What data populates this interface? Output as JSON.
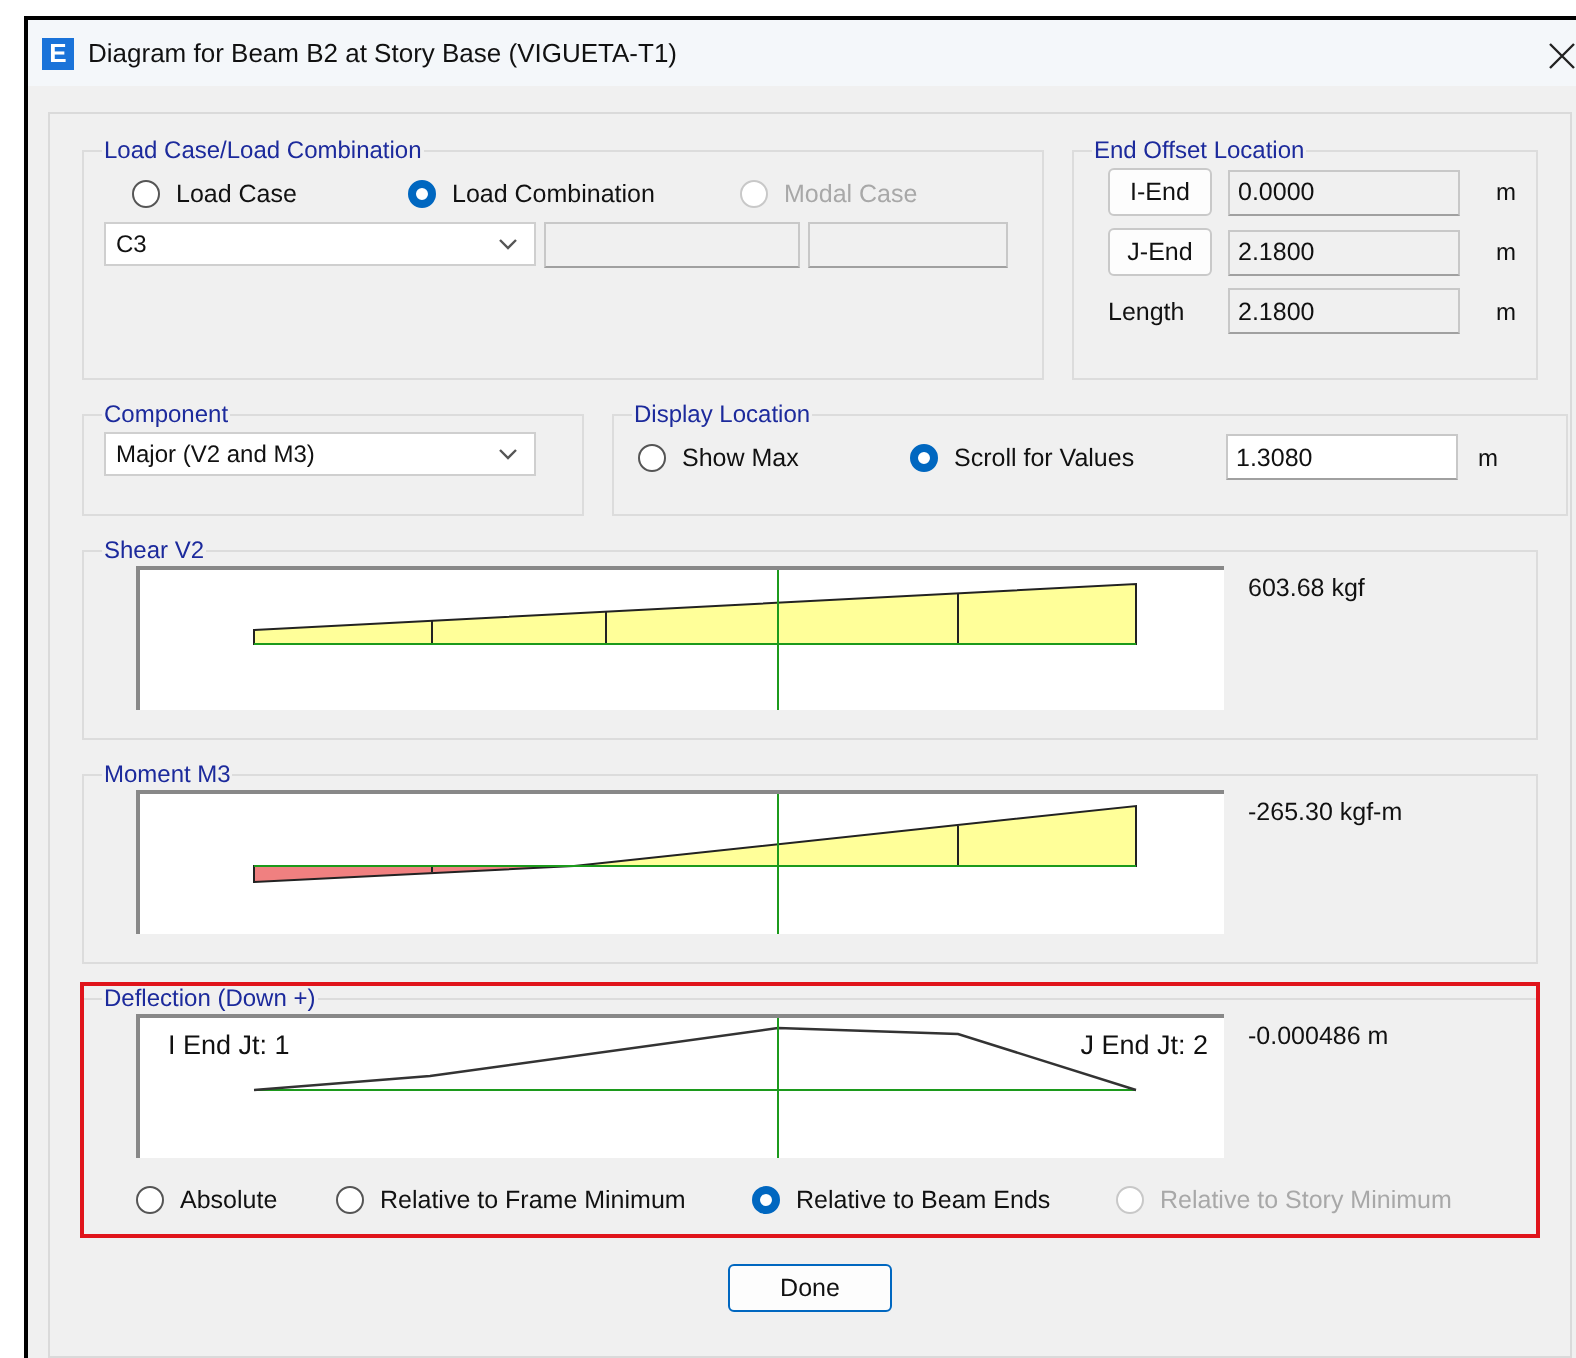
{
  "window": {
    "app_icon": "E",
    "title": "Diagram for Beam B2 at Story Base (VIGUETA-T1)"
  },
  "load_case": {
    "label": "Load Case/Load Combination",
    "options": [
      {
        "label": "Load Case",
        "selected": false,
        "disabled": false
      },
      {
        "label": "Load Combination",
        "selected": true,
        "disabled": false
      },
      {
        "label": "Modal Case",
        "selected": false,
        "disabled": true
      }
    ],
    "combo": {
      "value": "C3"
    }
  },
  "end_offset": {
    "label": "End Offset Location",
    "rows": [
      {
        "kind": "button",
        "label": "I-End",
        "value": "0.0000",
        "unit": "m"
      },
      {
        "kind": "button",
        "label": "J-End",
        "value": "2.1800",
        "unit": "m"
      },
      {
        "kind": "text",
        "label": "Length",
        "value": "2.1800",
        "unit": "m"
      }
    ]
  },
  "component": {
    "label": "Component",
    "value": "Major (V2 and M3)"
  },
  "display_location": {
    "label": "Display Location",
    "options": [
      {
        "label": "Show Max",
        "selected": false,
        "disabled": false
      },
      {
        "label": "Scroll for Values",
        "selected": true,
        "disabled": false
      }
    ],
    "value": "1.3080",
    "unit": "m"
  },
  "diagrams": [
    {
      "kind": "shear",
      "label": "Shear V2",
      "reading": "603.68 kgf",
      "highlighted": false
    },
    {
      "kind": "moment",
      "label": "Moment M3",
      "reading": "-265.30 kgf-m",
      "highlighted": false
    },
    {
      "kind": "deflection",
      "label": "Deflection (Down +)",
      "reading": "-0.000486 m",
      "highlighted": true,
      "i_end": "I End Jt: 1",
      "j_end": "J End Jt: 2",
      "options": [
        {
          "label": "Absolute",
          "selected": false,
          "disabled": false
        },
        {
          "label": "Relative to Frame Minimum",
          "selected": false,
          "disabled": false
        },
        {
          "label": "Relative to Beam Ends",
          "selected": true,
          "disabled": false
        },
        {
          "label": "Relative to Story Minimum",
          "selected": false,
          "disabled": true
        }
      ]
    }
  ],
  "buttons": [
    "Done"
  ]
}
